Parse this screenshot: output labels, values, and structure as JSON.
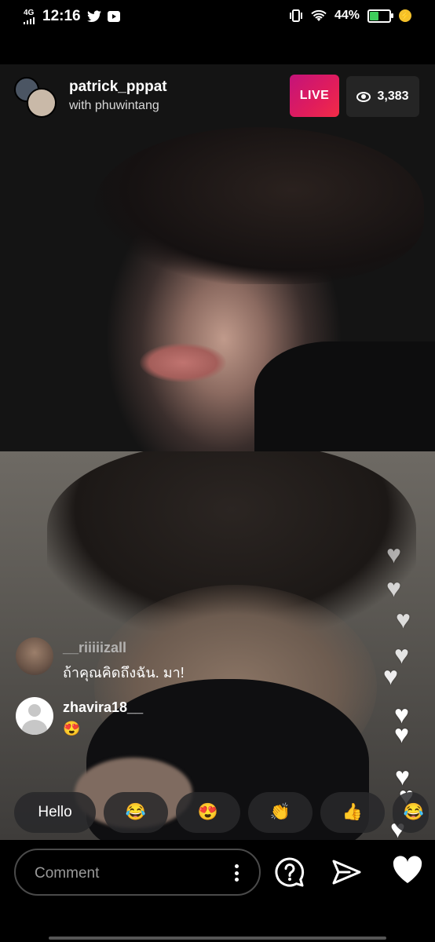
{
  "status_bar": {
    "network": "4G",
    "time": "12:16",
    "battery_percent": "44%"
  },
  "live": {
    "host_username": "patrick_pppat",
    "with_text": "with phuwintang",
    "live_label": "LIVE",
    "viewer_count": "3,383"
  },
  "comments": [
    {
      "username": "__riiiiizall",
      "text": "ถ้าคุณคิดถึงฉัน. มา!"
    },
    {
      "username": "zhavira18__",
      "text": "😍"
    }
  ],
  "quick_reactions": [
    "Hello",
    "😂",
    "😍",
    "👏",
    "👍",
    "😂"
  ],
  "composer": {
    "placeholder": "Comment"
  },
  "colors": {
    "live_gradient_start": "#c4137a",
    "live_gradient_end": "#f22c46",
    "battery_fill": "#3ecc5c"
  }
}
